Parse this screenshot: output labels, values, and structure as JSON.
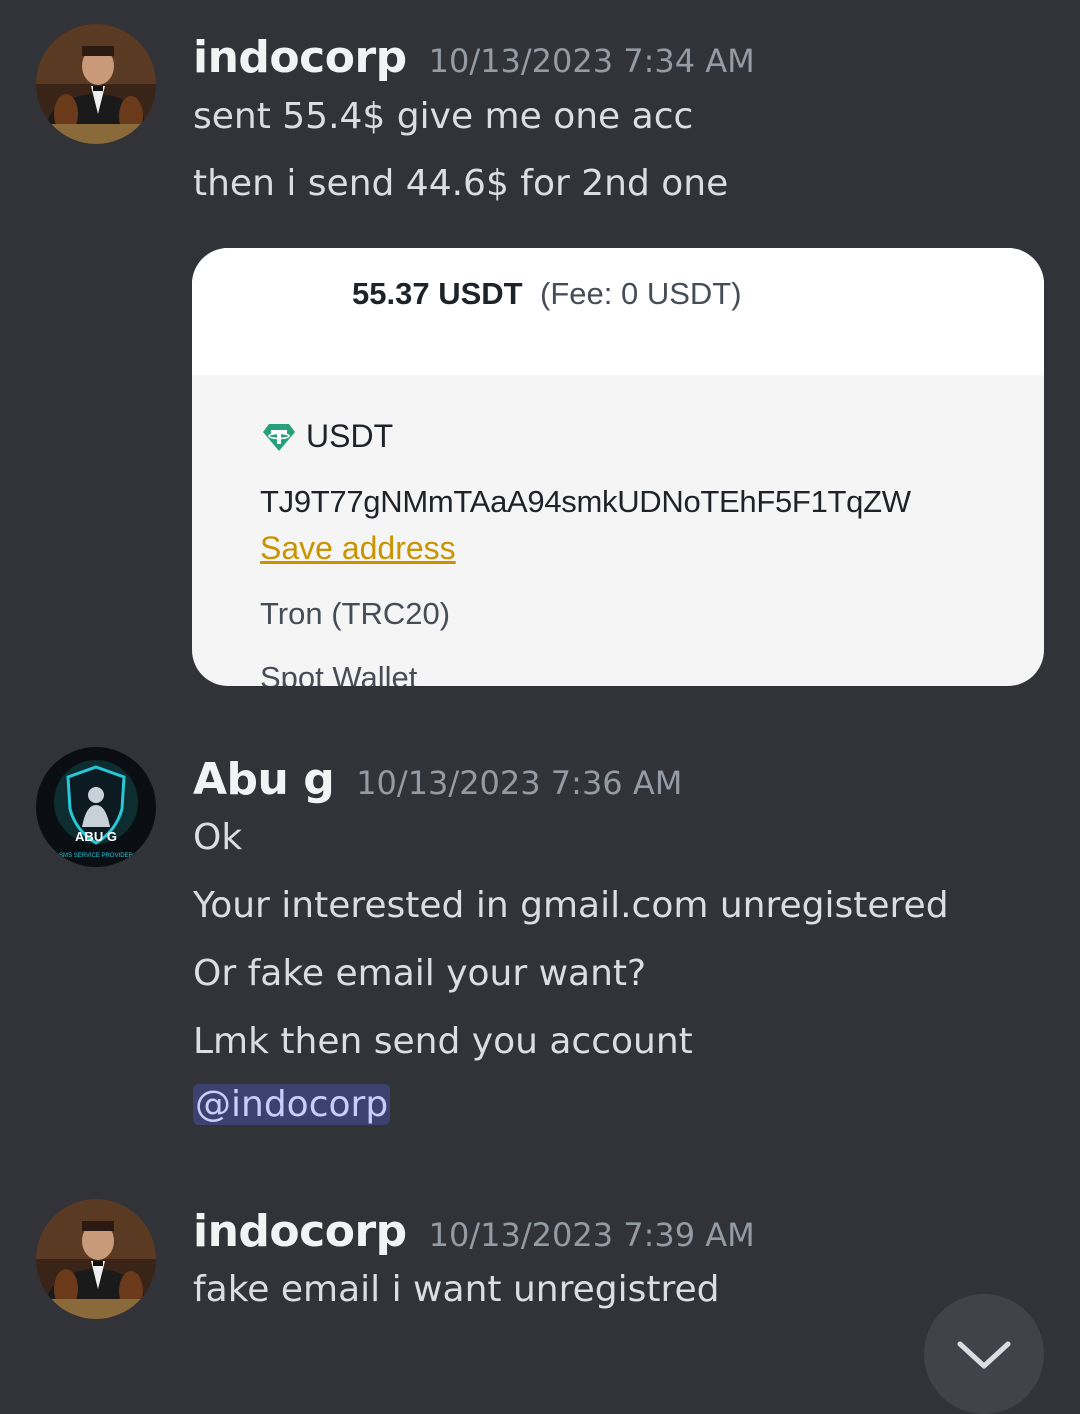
{
  "messages": [
    {
      "username": "indocorp",
      "timestamp": "10/13/2023 7:34 AM",
      "lines": [
        "sent 55.4$ give me one acc",
        "then i send 44.6$ for 2nd one"
      ],
      "attachment": {
        "amount": "55.37 USDT",
        "fee": "(Fee: 0 USDT)",
        "coin": "USDT",
        "address": "TJ9T77gNMmTAaA94smkUDNoTEhF5F1TqZW",
        "save_label": "Save address",
        "network": "Tron (TRC20)",
        "wallet": "Spot Wallet"
      }
    },
    {
      "username": "Abu g",
      "timestamp": "10/13/2023 7:36 AM",
      "avatar_text": "ABU G",
      "avatar_subtext": "SMS SERVICE PROVIDER",
      "lines": [
        "Ok",
        "Your interested in gmail.com unregistered",
        "Or fake email your want?",
        "Lmk then send you account"
      ],
      "mention": "@indocorp"
    },
    {
      "username": "indocorp",
      "timestamp": "10/13/2023 7:39 AM",
      "lines": [
        "fake email i want unregistred"
      ]
    }
  ],
  "colors": {
    "background": "#313338",
    "mention_bg": "#3c4270",
    "link": "#c99400",
    "usdt_green": "#26a17b"
  },
  "icons": {
    "scroll_down": "chevron-down-icon",
    "coin": "tether-icon"
  }
}
